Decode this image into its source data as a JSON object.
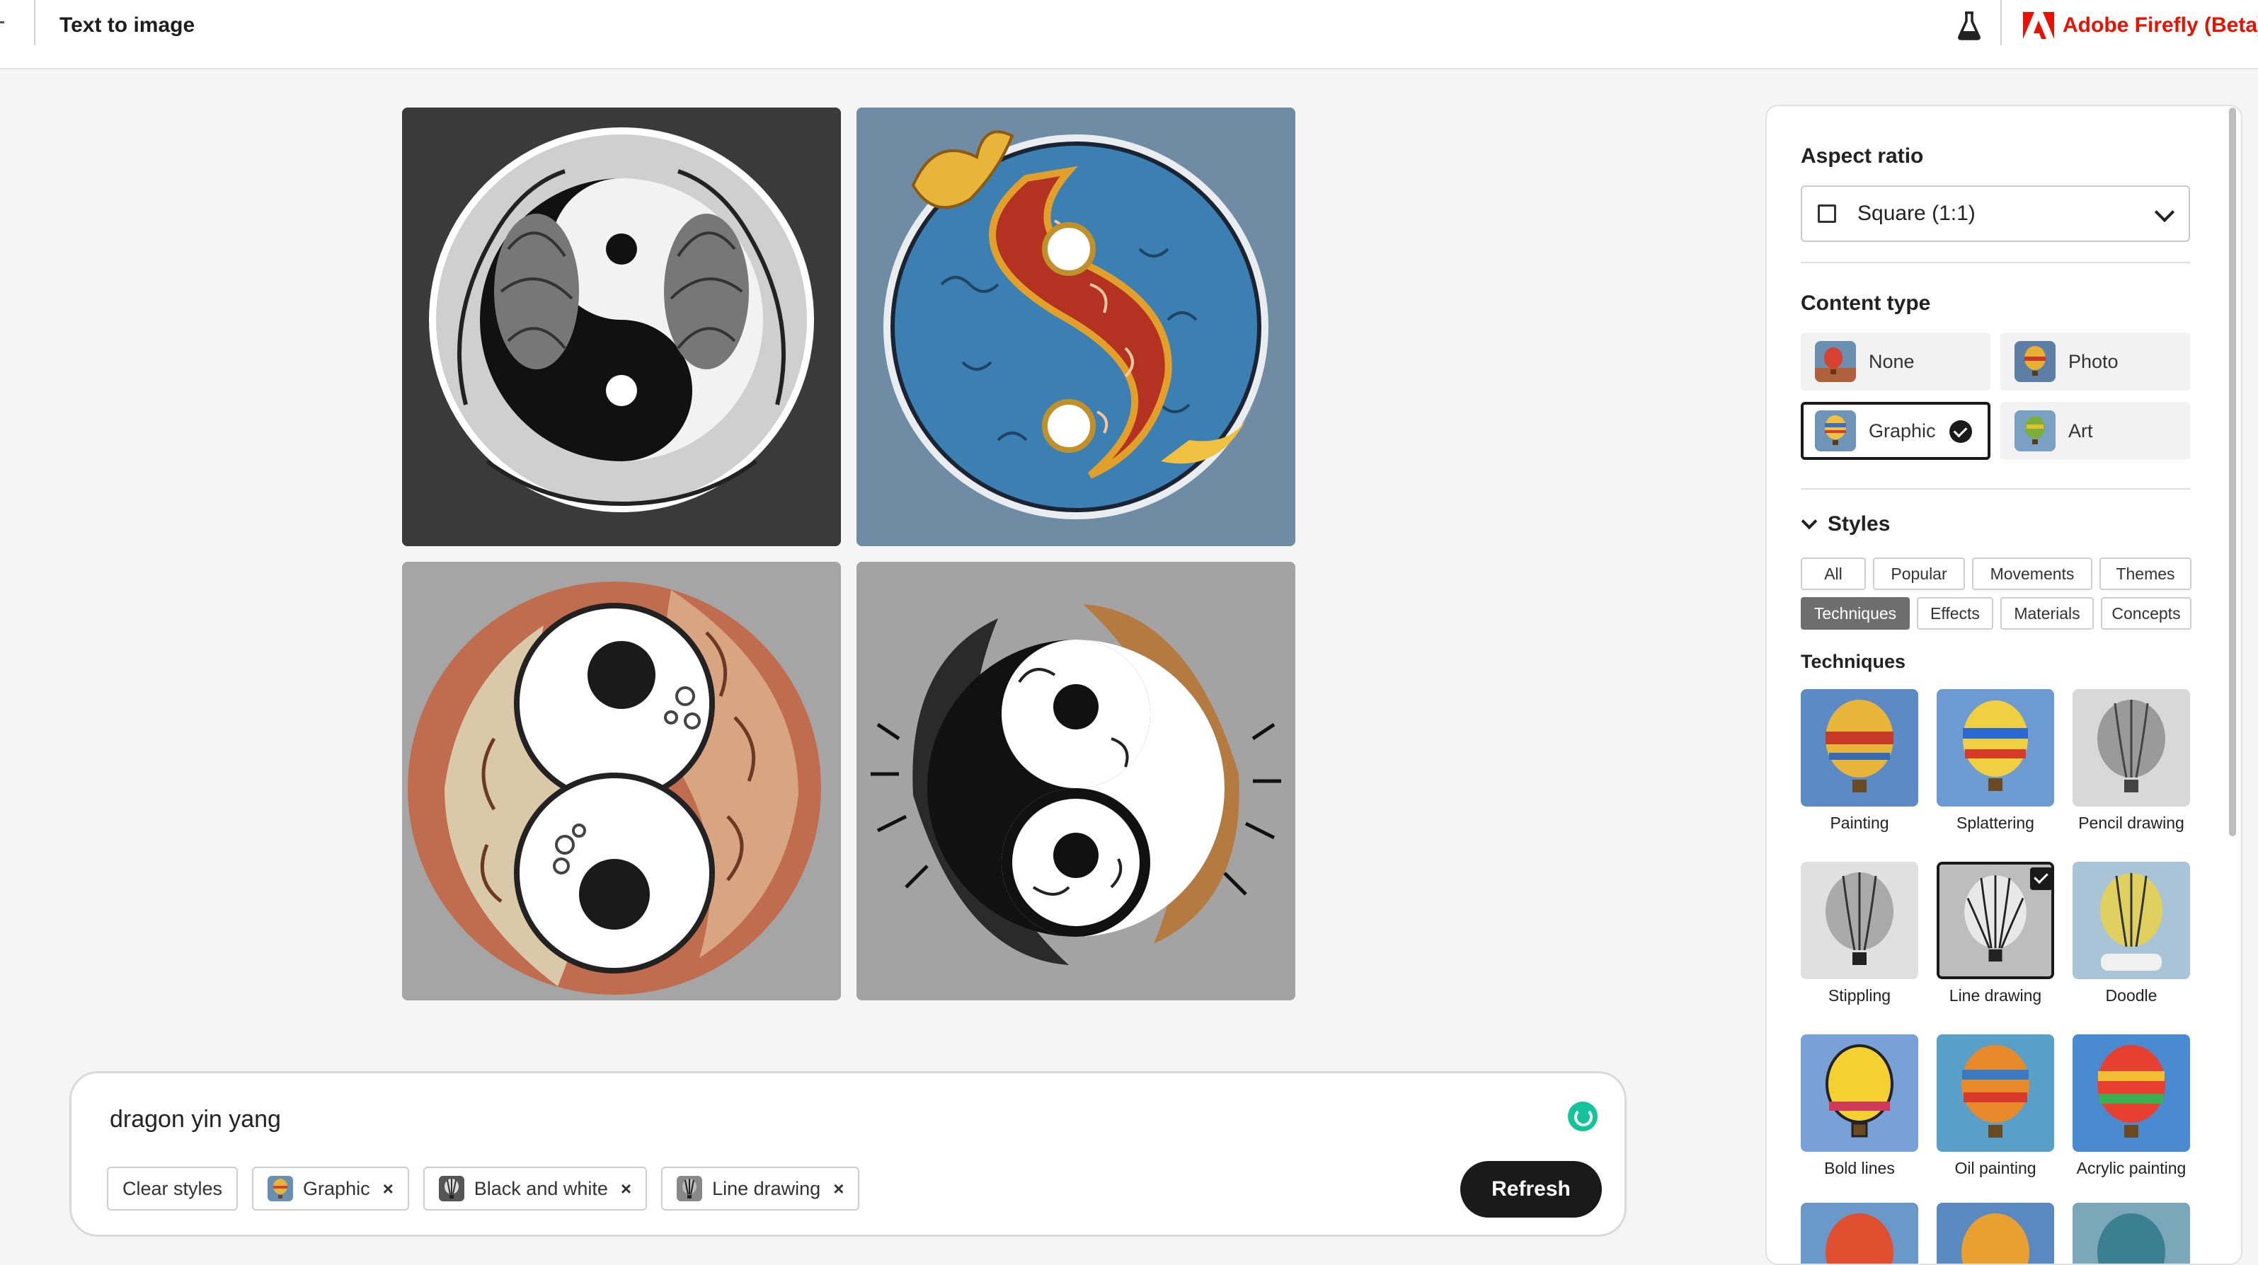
{
  "header": {
    "title": "Text to image",
    "brand_name": "Adobe Firefly (Beta)",
    "brand_color": "#eb1000"
  },
  "prompt": {
    "text": "dragon yin yang",
    "clear_styles_label": "Clear styles",
    "chips": [
      {
        "label": "Graphic",
        "icon": "balloon-thumb"
      },
      {
        "label": "Black and white",
        "icon": "balloon-bw-thumb"
      },
      {
        "label": "Line drawing",
        "icon": "balloon-line-thumb"
      }
    ],
    "refresh_label": "Refresh"
  },
  "panel": {
    "aspect_ratio": {
      "heading": "Aspect ratio",
      "selected": "Square (1:1)"
    },
    "content_type": {
      "heading": "Content type",
      "options": [
        {
          "label": "None",
          "selected": false
        },
        {
          "label": "Photo",
          "selected": false
        },
        {
          "label": "Graphic",
          "selected": true
        },
        {
          "label": "Art",
          "selected": false
        }
      ]
    },
    "styles": {
      "heading": "Styles",
      "tabs": [
        "All",
        "Popular",
        "Movements",
        "Themes",
        "Techniques",
        "Effects",
        "Materials",
        "Concepts"
      ],
      "active_tab": "Techniques",
      "section_heading": "Techniques",
      "techniques": [
        {
          "label": "Painting",
          "selected": false
        },
        {
          "label": "Splattering",
          "selected": false
        },
        {
          "label": "Pencil drawing",
          "selected": false
        },
        {
          "label": "Stippling",
          "selected": false
        },
        {
          "label": "Line drawing",
          "selected": true
        },
        {
          "label": "Doodle",
          "selected": false
        },
        {
          "label": "Bold lines",
          "selected": false
        },
        {
          "label": "Oil painting",
          "selected": false
        },
        {
          "label": "Acrylic painting",
          "selected": false
        }
      ]
    }
  },
  "generated_images": [
    {
      "name": "dragon-yin-yang-bw"
    },
    {
      "name": "dragon-yin-yang-red-blue"
    },
    {
      "name": "dragon-yin-yang-orange"
    },
    {
      "name": "dragon-yin-yang-bronze"
    }
  ]
}
